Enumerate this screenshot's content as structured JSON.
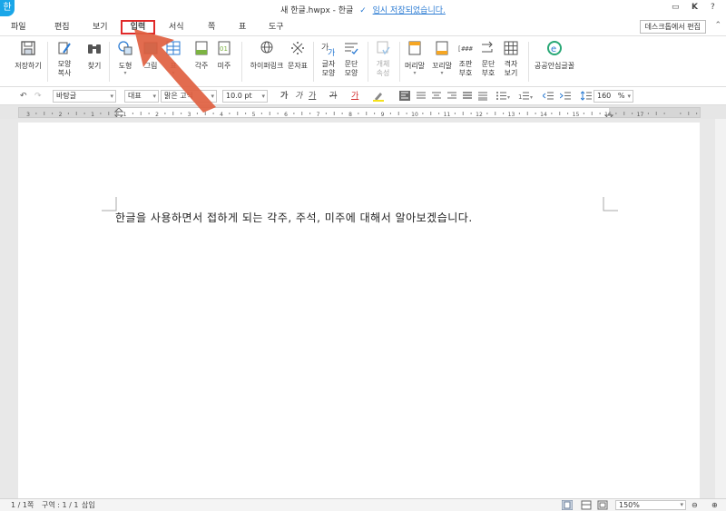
{
  "title_bar": {
    "logo": "한",
    "doc_title": "새 한글.hwpx - 한글",
    "save_status": "임시 저장되었습니다.",
    "btn_window": "▭",
    "btn_user": "K",
    "btn_help": "?"
  },
  "menu": {
    "tabs": [
      "파일",
      "편집",
      "보기",
      "입력",
      "서식",
      "쪽",
      "표",
      "도구"
    ],
    "active_tab": "입력",
    "desktop_edit": "데스크톱에서 편집",
    "collapse": "⌃"
  },
  "ribbon": {
    "save": "저장하기",
    "format_copy_1": "모양",
    "format_copy_2": "복사",
    "find": "찾기",
    "shape": "도형",
    "picture": "그림",
    "table": "표",
    "footnote": "각주",
    "endnote": "미주",
    "hyperlink": "하이퍼링크",
    "special_char": "문자표",
    "char_shape_1": "글자",
    "char_shape_2": "모양",
    "para_shape_1": "문단",
    "para_shape_2": "모양",
    "apply_style_1": "개체",
    "apply_style_2": "속성",
    "header": "머리말",
    "footer": "꼬리말",
    "field_1": "조판",
    "field_2": "부호",
    "para_mark_1": "문단",
    "para_mark_2": "부호",
    "grid_1": "격자",
    "grid_2": "보기",
    "gonggong_font": "공공안심글꼴"
  },
  "format_bar": {
    "undo": "↶",
    "redo": "↷",
    "style": "바탕글",
    "lang": "대표",
    "font": "맑은 고딕",
    "size": "10.0",
    "size_unit": "pt",
    "bold": "가",
    "italic": "가",
    "underline": "가",
    "strike": "가",
    "font_color": "가",
    "zoom_value": "160",
    "zoom_unit": "%"
  },
  "ruler_labels": [
    "3",
    "2",
    "1",
    "1",
    "2",
    "3",
    "4",
    "5",
    "6",
    "7",
    "8",
    "9",
    "10",
    "11",
    "12",
    "13",
    "14",
    "15",
    "16",
    "17"
  ],
  "document": {
    "body_text": "한글을 사용하면서 접하게 되는 각주, 주석, 미주에 대해서 알아보겠습니다."
  },
  "status_bar": {
    "page": "1 / 1쪽",
    "section": "구역 : 1 / 1",
    "mode": "삽입",
    "zoom": "150%"
  },
  "colors": {
    "accent_blue": "#1aa6e8",
    "active_tab_border": "#e02929",
    "arrow": "#e06040"
  }
}
